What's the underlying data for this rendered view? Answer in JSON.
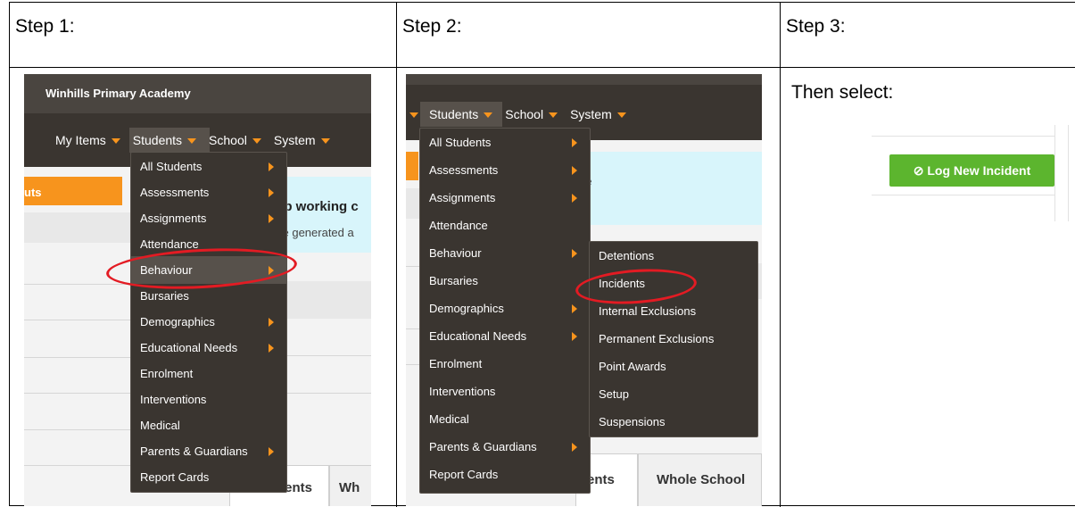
{
  "steps": {
    "step1": "Step 1:",
    "step2": "Step 2:",
    "step3": "Step 3:",
    "then_select": "Then select:"
  },
  "screen1": {
    "school_name": "Winhills Primary Academy",
    "nav": [
      "My Items",
      "Students",
      "School",
      "System"
    ],
    "orange_bar_text": "uts",
    "banner_title_fragment": "ep working c",
    "banner_sub_fragment": "ve generated a",
    "menu": [
      {
        "label": "All Students",
        "submenu": true
      },
      {
        "label": "Assessments",
        "submenu": true
      },
      {
        "label": "Assignments",
        "submenu": true
      },
      {
        "label": "Attendance",
        "submenu": false
      },
      {
        "label": "Behaviour",
        "submenu": true
      },
      {
        "label": "Bursaries",
        "submenu": false
      },
      {
        "label": "Demographics",
        "submenu": true
      },
      {
        "label": "Educational Needs",
        "submenu": true
      },
      {
        "label": "Enrolment",
        "submenu": false
      },
      {
        "label": "Interventions",
        "submenu": false
      },
      {
        "label": "Medical",
        "submenu": false
      },
      {
        "label": "Parents & Guardians",
        "submenu": true
      },
      {
        "label": "Report Cards",
        "submenu": false
      }
    ],
    "highlighted": "Behaviour",
    "tabs": [
      "ents",
      "Wh"
    ]
  },
  "screen2": {
    "nav": [
      "Students",
      "School",
      "System"
    ],
    "banner_fragment": "e",
    "menu": [
      {
        "label": "All Students",
        "submenu": true
      },
      {
        "label": "Assessments",
        "submenu": true
      },
      {
        "label": "Assignments",
        "submenu": true
      },
      {
        "label": "Attendance",
        "submenu": false
      },
      {
        "label": "Behaviour",
        "submenu": true
      },
      {
        "label": "Bursaries",
        "submenu": false
      },
      {
        "label": "Demographics",
        "submenu": true
      },
      {
        "label": "Educational Needs",
        "submenu": true
      },
      {
        "label": "Enrolment",
        "submenu": false
      },
      {
        "label": "Interventions",
        "submenu": false
      },
      {
        "label": "Medical",
        "submenu": false
      },
      {
        "label": "Parents & Guardians",
        "submenu": true
      },
      {
        "label": "Report Cards",
        "submenu": false
      }
    ],
    "submenu": [
      "Detentions",
      "Incidents",
      "Internal Exclusions",
      "Permanent Exclusions",
      "Point Awards",
      "Setup",
      "Suspensions"
    ],
    "highlighted": "Incidents",
    "tabs": [
      "ents",
      "Whole School"
    ]
  },
  "screen3": {
    "button_icon": "⊘",
    "button_label": "Log New Incident"
  },
  "colors": {
    "accent_orange": "#f7941d",
    "menu_bg": "#3a3530",
    "highlight_ring": "#e31b23",
    "button_green": "#5cb52e",
    "banner_cyan": "#d8f5fb"
  }
}
